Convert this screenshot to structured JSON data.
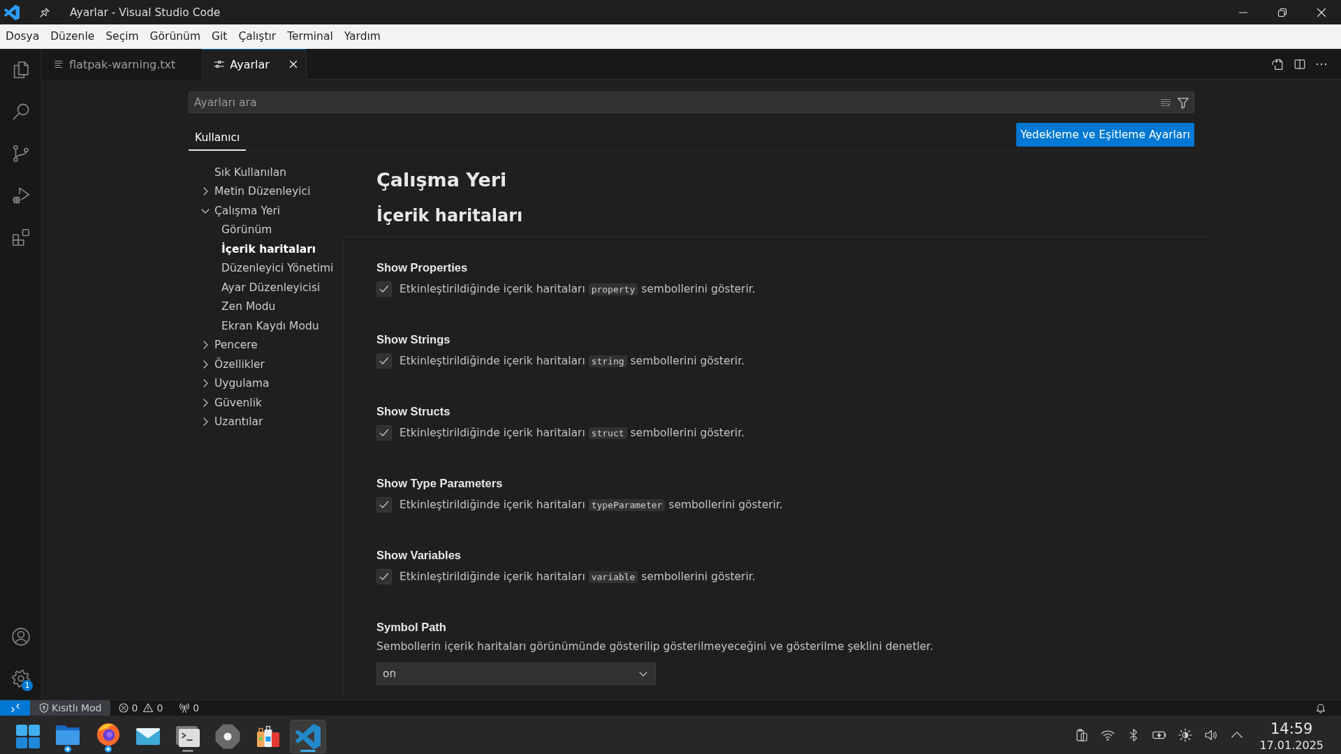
{
  "window": {
    "title": "Ayarlar - Visual Studio Code"
  },
  "menu_bar": [
    "Dosya",
    "Düzenle",
    "Seçim",
    "Görünüm",
    "Git",
    "Çalıştır",
    "Terminal",
    "Yardım"
  ],
  "activity_bar": {
    "manage_badge": "1"
  },
  "tabs": [
    {
      "label": "flatpak-warning.txt",
      "kind": "text-file",
      "selected": false
    },
    {
      "label": "Ayarlar",
      "kind": "settings",
      "selected": true
    }
  ],
  "settings_editor": {
    "search": {
      "placeholder": "Ayarları ara"
    },
    "scope_tabs": [
      {
        "label": "Kullanıcı",
        "selected": true
      }
    ],
    "sync_button": "Yedekleme ve Eşitleme Ayarları",
    "toc": [
      {
        "label": "Sık Kullanılan",
        "kind": "leaf",
        "selected": false
      },
      {
        "label": "Metin Düzenleyici",
        "kind": "group",
        "expanded": false,
        "selected": false
      },
      {
        "label": "Çalışma Yeri",
        "kind": "group",
        "expanded": true,
        "selected": false,
        "children": [
          {
            "label": "Görünüm",
            "selected": false
          },
          {
            "label": "İçerik haritaları",
            "selected": true
          },
          {
            "label": "Düzenleyici Yönetimi",
            "selected": false
          },
          {
            "label": "Ayar Düzenleyicisi",
            "selected": false
          },
          {
            "label": "Zen Modu",
            "selected": false
          },
          {
            "label": "Ekran Kaydı Modu",
            "selected": false
          }
        ]
      },
      {
        "label": "Pencere",
        "kind": "group",
        "expanded": false,
        "selected": false
      },
      {
        "label": "Özellikler",
        "kind": "group",
        "expanded": false,
        "selected": false
      },
      {
        "label": "Uygulama",
        "kind": "group",
        "expanded": false,
        "selected": false
      },
      {
        "label": "Güvenlik",
        "kind": "group",
        "expanded": false,
        "selected": false
      },
      {
        "label": "Uzantılar",
        "kind": "group",
        "expanded": false,
        "selected": false
      }
    ],
    "category": "Çalışma Yeri",
    "section": "İçerik haritaları",
    "settings": [
      {
        "kind": "checkbox",
        "title": "Show Properties",
        "checked": true,
        "description": {
          "before": "Etkinleştirildiğinde içerik haritaları ",
          "code": "property",
          "after": " sembollerini gösterir."
        }
      },
      {
        "kind": "checkbox",
        "title": "Show Strings",
        "checked": true,
        "description": {
          "before": "Etkinleştirildiğinde içerik haritaları ",
          "code": "string",
          "after": " sembollerini gösterir."
        }
      },
      {
        "kind": "checkbox",
        "title": "Show Structs",
        "checked": true,
        "description": {
          "before": "Etkinleştirildiğinde içerik haritaları ",
          "code": "struct",
          "after": " sembollerini gösterir."
        }
      },
      {
        "kind": "checkbox",
        "title": "Show Type Parameters",
        "checked": true,
        "description": {
          "before": "Etkinleştirildiğinde içerik haritaları ",
          "code": "typeParameter",
          "after": " sembollerini gösterir."
        }
      },
      {
        "kind": "checkbox",
        "title": "Show Variables",
        "checked": true,
        "description": {
          "before": "Etkinleştirildiğinde içerik haritaları ",
          "code": "variable",
          "after": " sembollerini gösterir."
        }
      },
      {
        "kind": "dropdown",
        "title": "Symbol Path",
        "description": {
          "before": "Sembollerin içerik haritaları görünümünde gösterilip gösterilmeyeceğini ve gösterilme şeklini denetler."
        },
        "value": "on"
      }
    ]
  },
  "status_bar": {
    "restricted_mode": "Kısıtlı Mod",
    "errors": "0",
    "warnings": "0",
    "ports": "0"
  },
  "taskbar": {
    "apps": [
      {
        "kind": "start",
        "running": false,
        "active": false
      },
      {
        "kind": "files",
        "running": false,
        "active": false
      },
      {
        "kind": "browser",
        "running": false,
        "active": false
      },
      {
        "kind": "mail",
        "running": false,
        "active": false
      },
      {
        "kind": "terminal",
        "running": true,
        "active": false
      },
      {
        "kind": "system-settings",
        "running": false,
        "active": false
      },
      {
        "kind": "store",
        "running": false,
        "active": false
      },
      {
        "kind": "vscode",
        "running": true,
        "active": true
      }
    ],
    "clock": {
      "time": "14:59",
      "date": "17.01.2025"
    }
  }
}
